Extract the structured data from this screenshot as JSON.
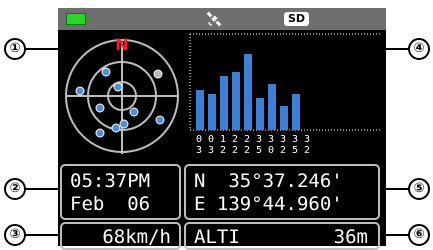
{
  "status": {
    "battery_icon": "battery-full-icon",
    "gps_icon": "satellite-icon",
    "sd_label": "SD"
  },
  "compass": {
    "north_label": "N",
    "north_color": "#ff1e1e"
  },
  "satellites_plotted": 10,
  "signal_chart": {
    "bar_color": "#3b7fd6",
    "channel_labels": [
      [
        "0",
        "3"
      ],
      [
        "0",
        "3"
      ],
      [
        "1",
        "2"
      ],
      [
        "2",
        "2"
      ],
      [
        "2",
        "2"
      ],
      [
        "3",
        "5"
      ],
      [
        "3",
        "0"
      ],
      [
        "3",
        "2"
      ],
      [
        "3",
        "5"
      ],
      [
        "3",
        "2"
      ]
    ]
  },
  "time": {
    "clock": "05:37PM",
    "date": "Feb  06"
  },
  "position": {
    "lat": "N  35°37.246'",
    "lon": "E 139°44.960'"
  },
  "speed": {
    "value": "68km/h"
  },
  "altitude": {
    "label": "ALTI",
    "value": "36m"
  },
  "callouts": [
    "①",
    "②",
    "③",
    "④",
    "⑤",
    "⑥"
  ]
}
